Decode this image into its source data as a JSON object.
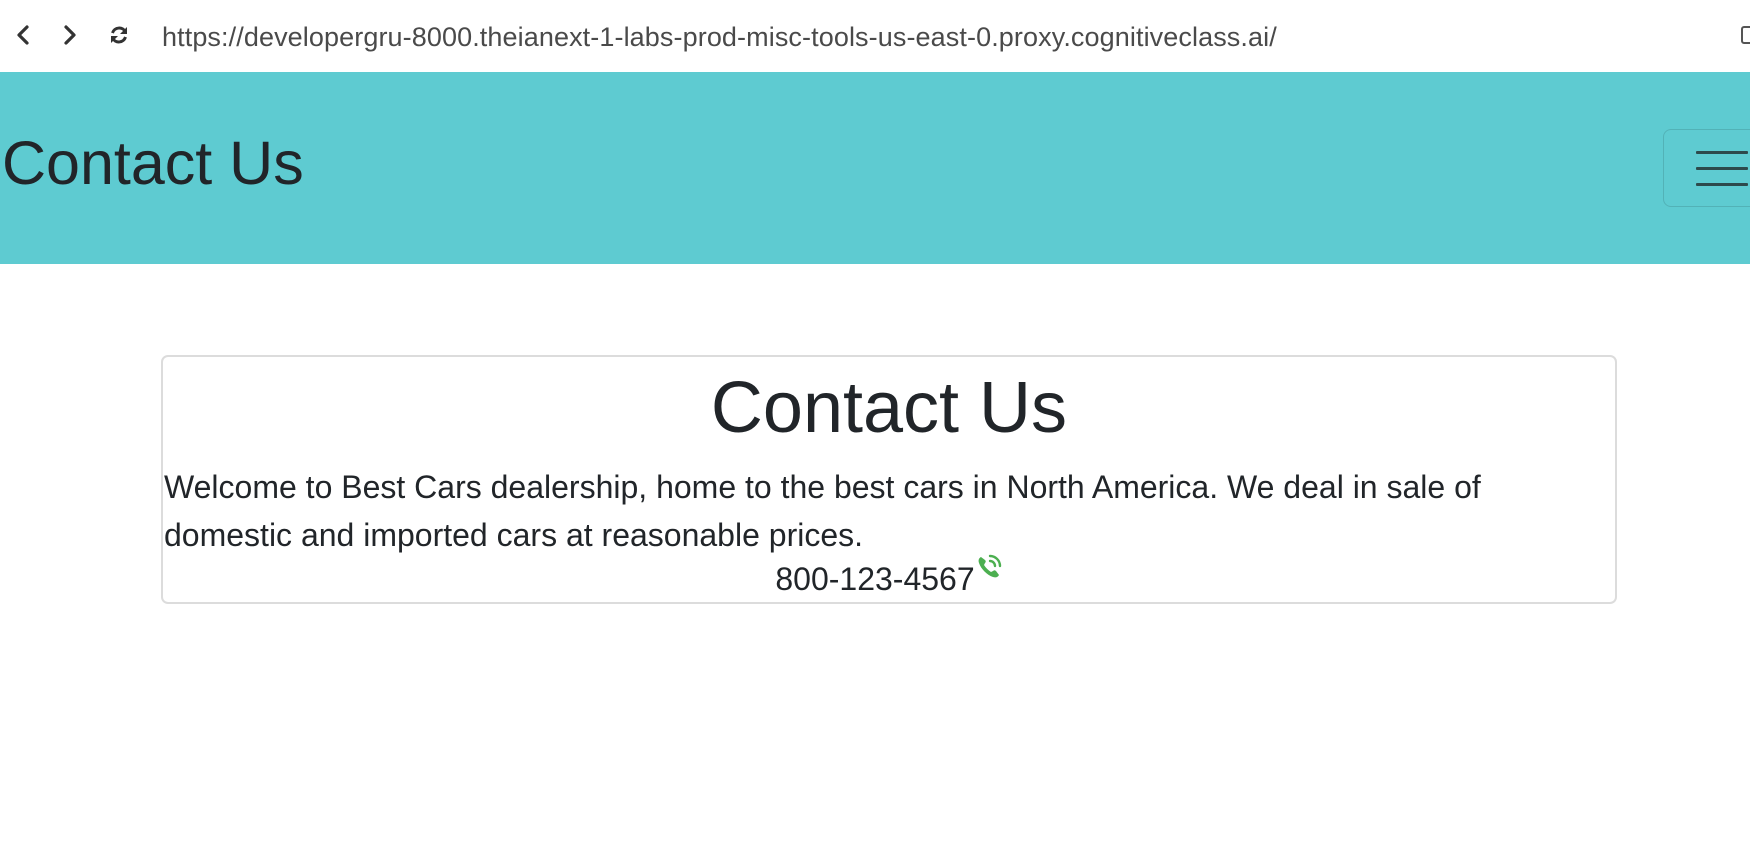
{
  "browser": {
    "url": "https://developergru-8000.theianext-1-labs-prod-misc-tools-us-east-0.proxy.cognitiveclass.ai/",
    "back_icon": "chevron-left-icon",
    "forward_icon": "chevron-right-icon",
    "reload_icon": "reload-icon"
  },
  "header": {
    "title": "Contact Us",
    "background_color": "#5ecbd1",
    "menu_icon": "hamburger-menu-icon"
  },
  "card": {
    "title": "Contact Us",
    "text": "Welcome to Best Cars dealership, home to the best cars in North America. We deal in sale of domestic and imported cars at reasonable prices.",
    "phone": "800-123-4567",
    "phone_icon": "phone-icon",
    "phone_icon_color": "#4caf50"
  }
}
